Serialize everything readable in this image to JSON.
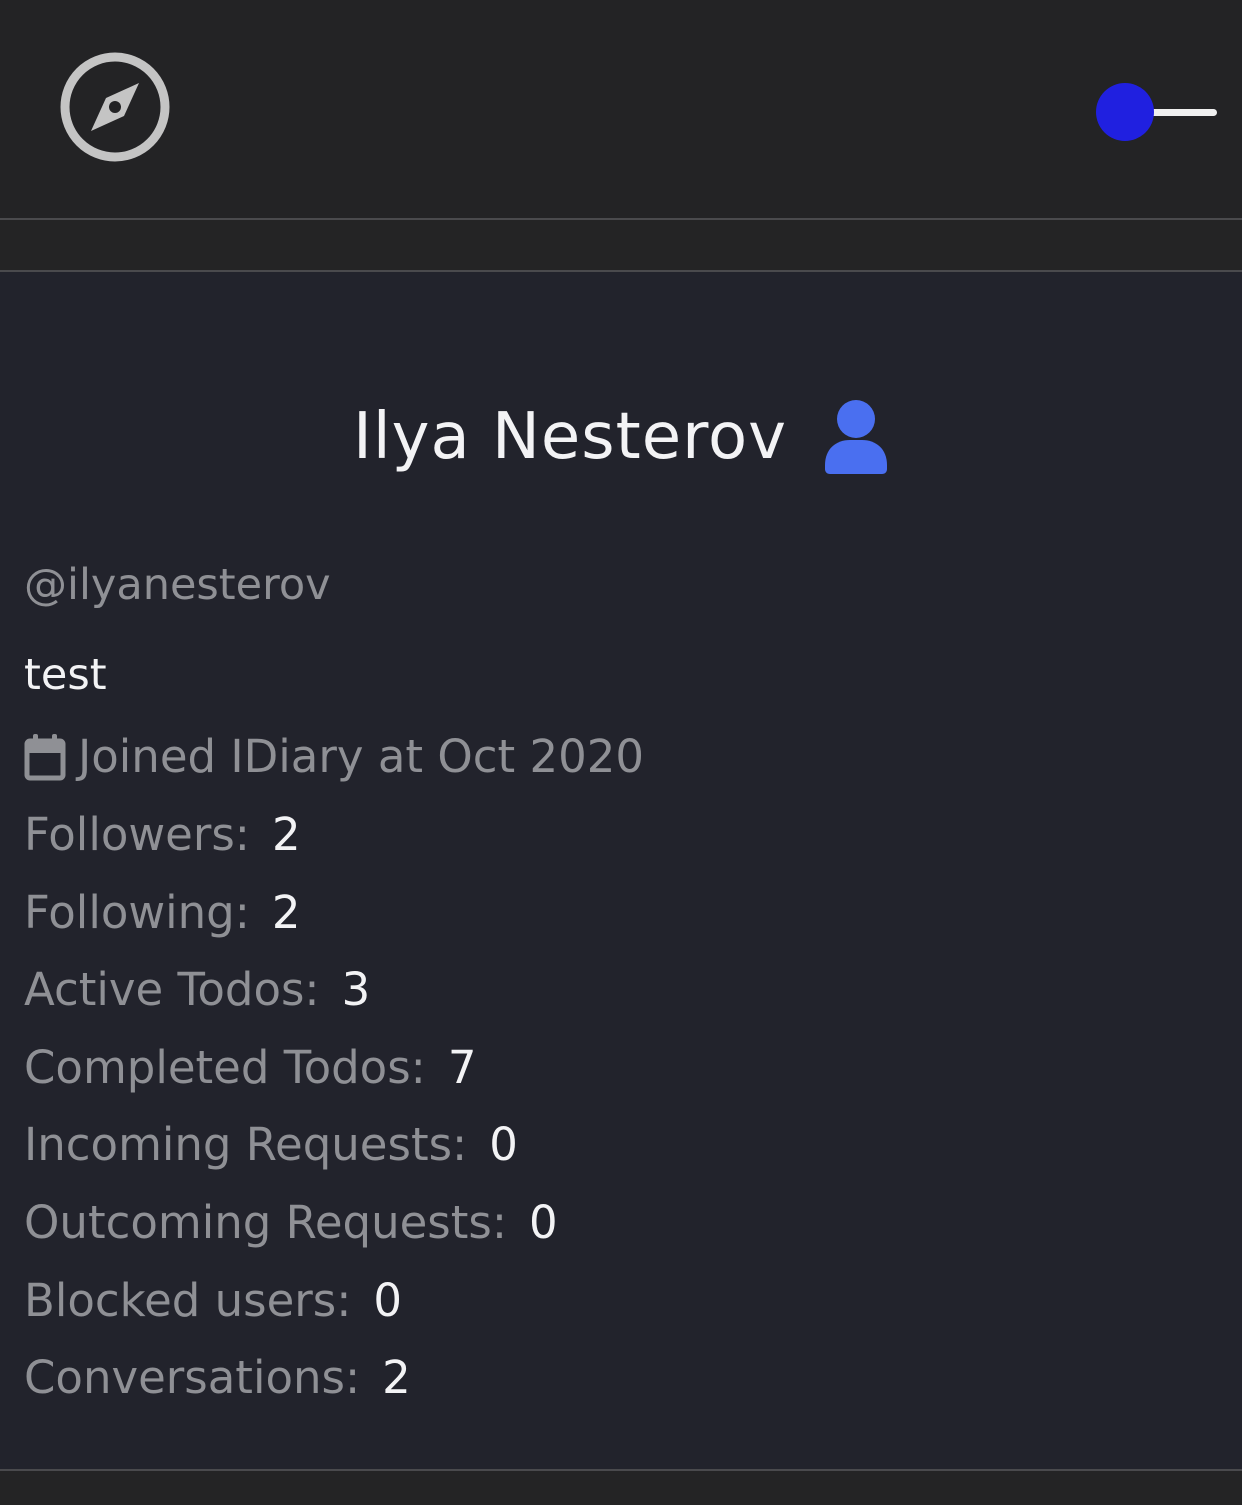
{
  "header": {
    "nav_icon": "compass-icon",
    "theme_toggle": {
      "state": "on",
      "knob_color": "#2020e0",
      "track_color": "#f0f0f0"
    }
  },
  "profile": {
    "name": "Ilya Nesterov",
    "name_icon": "user-icon",
    "name_icon_color": "#4a6ff0",
    "handle": "@ilyanesterov",
    "bio": "test",
    "joined_icon": "calendar-icon",
    "joined": "Joined IDiary at Oct 2020",
    "stats": [
      {
        "label": "Followers:",
        "value": "2"
      },
      {
        "label": "Following:",
        "value": "2"
      },
      {
        "label": "Active Todos:",
        "value": "3"
      },
      {
        "label": "Completed Todos:",
        "value": "7"
      },
      {
        "label": "Incoming Requests:",
        "value": "0"
      },
      {
        "label": "Outcoming Requests:",
        "value": "0"
      },
      {
        "label": "Blocked users:",
        "value": "0"
      },
      {
        "label": "Conversations:",
        "value": "2"
      }
    ]
  }
}
